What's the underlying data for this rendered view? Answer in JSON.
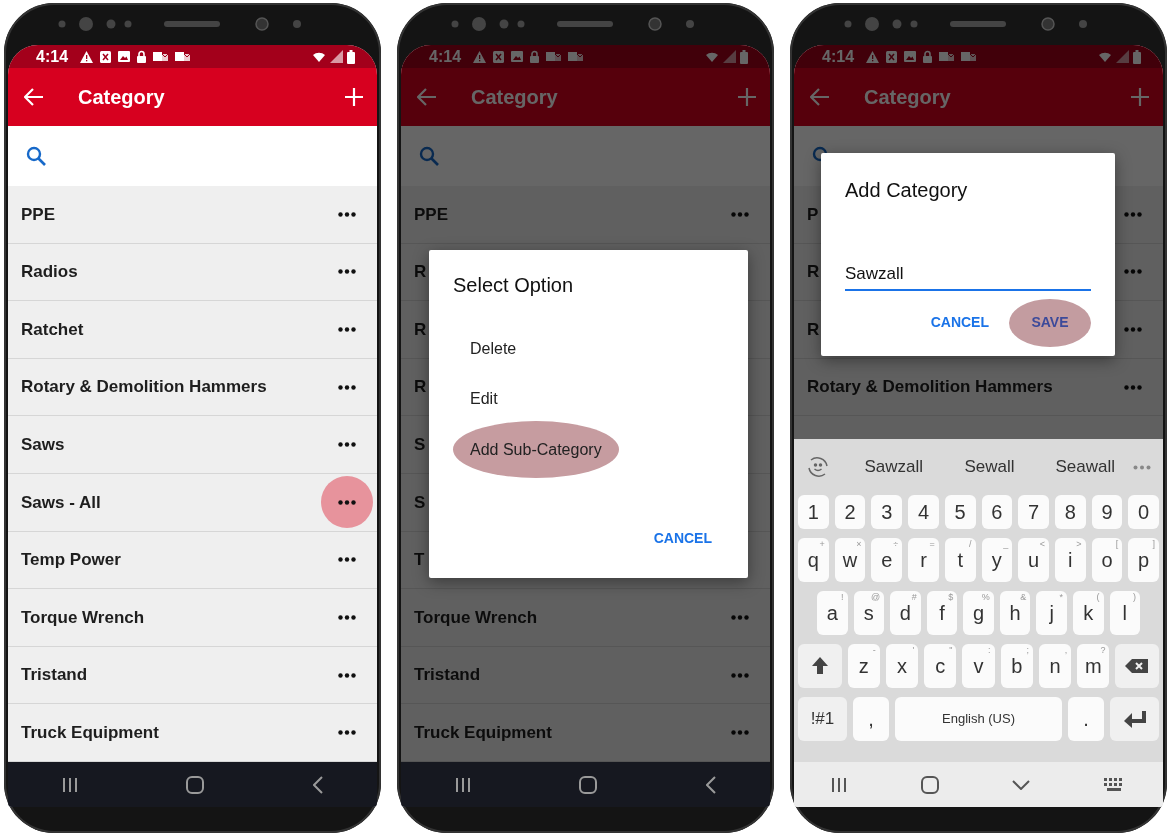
{
  "phones": [
    {
      "status_time": "4:14",
      "title": "Category",
      "dimmed": false,
      "rows": [
        {
          "label": "PPE",
          "menu": true,
          "tapped": false
        },
        {
          "label": "Radios",
          "menu": true,
          "tapped": false
        },
        {
          "label": "Ratchet",
          "menu": true,
          "tapped": false
        },
        {
          "label": "Rotary & Demolition Hammers",
          "menu": true,
          "tapped": false
        },
        {
          "label": "Saws",
          "menu": true,
          "tapped": false
        },
        {
          "label": "Saws - All",
          "menu": true,
          "tapped": true
        },
        {
          "label": "Temp Power",
          "menu": true,
          "tapped": false
        },
        {
          "label": "Torque Wrench",
          "menu": true,
          "tapped": false
        },
        {
          "label": "Tristand",
          "menu": true,
          "tapped": false
        },
        {
          "label": "Truck Equipment",
          "menu": true,
          "tapped": false
        }
      ]
    },
    {
      "status_time": "4:14",
      "title": "Category",
      "dimmed": true,
      "rows": [
        {
          "label": "PPE",
          "menu": true,
          "tapped": false
        },
        {
          "label": "R",
          "menu": false,
          "tapped": false
        },
        {
          "label": "R",
          "menu": false,
          "tapped": false
        },
        {
          "label": "R",
          "menu": false,
          "tapped": false
        },
        {
          "label": "S",
          "menu": false,
          "tapped": false
        },
        {
          "label": "S",
          "menu": false,
          "tapped": false
        },
        {
          "label": "T",
          "menu": false,
          "tapped": false
        },
        {
          "label": "Torque Wrench",
          "menu": true,
          "tapped": false
        },
        {
          "label": "Tristand",
          "menu": true,
          "tapped": false
        },
        {
          "label": "Truck Equipment",
          "menu": true,
          "tapped": false
        }
      ],
      "dialog": {
        "kind": "options",
        "title": "Select Option",
        "options": [
          {
            "label": "Delete",
            "tapped": false
          },
          {
            "label": "Edit",
            "tapped": false
          },
          {
            "label": "Add Sub-Category",
            "tapped": true
          }
        ],
        "buttons": [
          {
            "label": "CANCEL",
            "tapped": false
          }
        ]
      }
    },
    {
      "status_time": "4:14",
      "title": "Category",
      "dimmed": true,
      "rows": [
        {
          "label": "P",
          "menu": true,
          "tapped": false
        },
        {
          "label": "R",
          "menu": true,
          "tapped": false
        },
        {
          "label": "R",
          "menu": true,
          "tapped": false
        },
        {
          "label": "Rotary & Demolition Hammers",
          "menu": true,
          "tapped": false
        }
      ],
      "dialog": {
        "kind": "input",
        "title": "Add Category",
        "value": "Sawzall",
        "buttons": [
          {
            "label": "CANCEL",
            "tapped": false
          },
          {
            "label": "SAVE",
            "tapped": true
          }
        ]
      },
      "keyboard": {
        "suggestions": [
          "Sawzall",
          "Sewall",
          "Seawall"
        ],
        "rows": [
          {
            "keys": [
              {
                "kind": "digit",
                "label": "1"
              },
              {
                "kind": "digit",
                "label": "2"
              },
              {
                "kind": "digit",
                "label": "3"
              },
              {
                "kind": "digit",
                "label": "4"
              },
              {
                "kind": "digit",
                "label": "5"
              },
              {
                "kind": "digit",
                "label": "6"
              },
              {
                "kind": "digit",
                "label": "7"
              },
              {
                "kind": "digit",
                "label": "8"
              },
              {
                "kind": "digit",
                "label": "9"
              },
              {
                "kind": "digit",
                "label": "0"
              }
            ]
          },
          {
            "keys": [
              {
                "kind": "char",
                "label": "q",
                "alt": "+"
              },
              {
                "kind": "char",
                "label": "w",
                "alt": "×"
              },
              {
                "kind": "char",
                "label": "e",
                "alt": "÷"
              },
              {
                "kind": "char",
                "label": "r",
                "alt": "="
              },
              {
                "kind": "char",
                "label": "t",
                "alt": "/"
              },
              {
                "kind": "char",
                "label": "y",
                "alt": "_"
              },
              {
                "kind": "char",
                "label": "u",
                "alt": "<"
              },
              {
                "kind": "char",
                "label": "i",
                "alt": ">"
              },
              {
                "kind": "char",
                "label": "o",
                "alt": "["
              },
              {
                "kind": "char",
                "label": "p",
                "alt": "]"
              }
            ]
          },
          {
            "keys": [
              {
                "kind": "char",
                "label": "a",
                "alt": "!"
              },
              {
                "kind": "char",
                "label": "s",
                "alt": "@"
              },
              {
                "kind": "char",
                "label": "d",
                "alt": "#"
              },
              {
                "kind": "char",
                "label": "f",
                "alt": "$"
              },
              {
                "kind": "char",
                "label": "g",
                "alt": "%"
              },
              {
                "kind": "char",
                "label": "h",
                "alt": "&"
              },
              {
                "kind": "char",
                "label": "j",
                "alt": "*"
              },
              {
                "kind": "char",
                "label": "k",
                "alt": "("
              },
              {
                "kind": "char",
                "label": "l",
                "alt": ")"
              }
            ]
          },
          {
            "keys": [
              {
                "kind": "shift"
              },
              {
                "kind": "char",
                "label": "z",
                "alt": "-"
              },
              {
                "kind": "char",
                "label": "x",
                "alt": "'"
              },
              {
                "kind": "char",
                "label": "c",
                "alt": "\""
              },
              {
                "kind": "char",
                "label": "v",
                "alt": ":"
              },
              {
                "kind": "char",
                "label": "b",
                "alt": ";"
              },
              {
                "kind": "char",
                "label": "n",
                "alt": ","
              },
              {
                "kind": "char",
                "label": "m",
                "alt": "?"
              },
              {
                "kind": "backspace"
              }
            ]
          },
          {
            "keys": [
              {
                "kind": "mode",
                "label": "!#1"
              },
              {
                "kind": "char",
                "label": ","
              },
              {
                "kind": "space",
                "label": "English (US)"
              },
              {
                "kind": "char",
                "label": "."
              },
              {
                "kind": "enter"
              }
            ]
          }
        ]
      }
    }
  ]
}
